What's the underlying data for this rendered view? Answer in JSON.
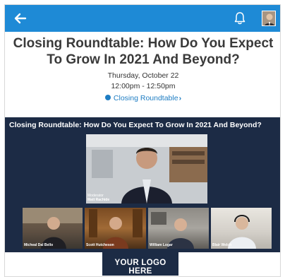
{
  "header": {
    "back_icon": "arrow-left-icon",
    "bell_icon": "bell-icon",
    "avatar_icon": "user-avatar",
    "bar_color": "#1e8ad6"
  },
  "session": {
    "title": "Closing Roundtable: How Do You Expect To Grow In 2021 And Beyond?",
    "date": "Thursday, October 22",
    "time": "12:00pm - 12:50pm",
    "link_label": "Closing Roundtable",
    "link_chevron": "›",
    "link_color": "#1e7dc3"
  },
  "video": {
    "title": "Closing Roundtable: How Do You Expect To Grow In 2021 And Beyond?",
    "main": {
      "role": "Moderator",
      "name": "Matt Rachide"
    },
    "participants": [
      {
        "name": "Micheal Dal Bello"
      },
      {
        "name": "Scott Hutcheson"
      },
      {
        "name": "William Logar"
      },
      {
        "name": "Blair Welch"
      }
    ],
    "background_color": "#1c2b45"
  },
  "logo": {
    "text": "YOUR LOGO HERE"
  }
}
